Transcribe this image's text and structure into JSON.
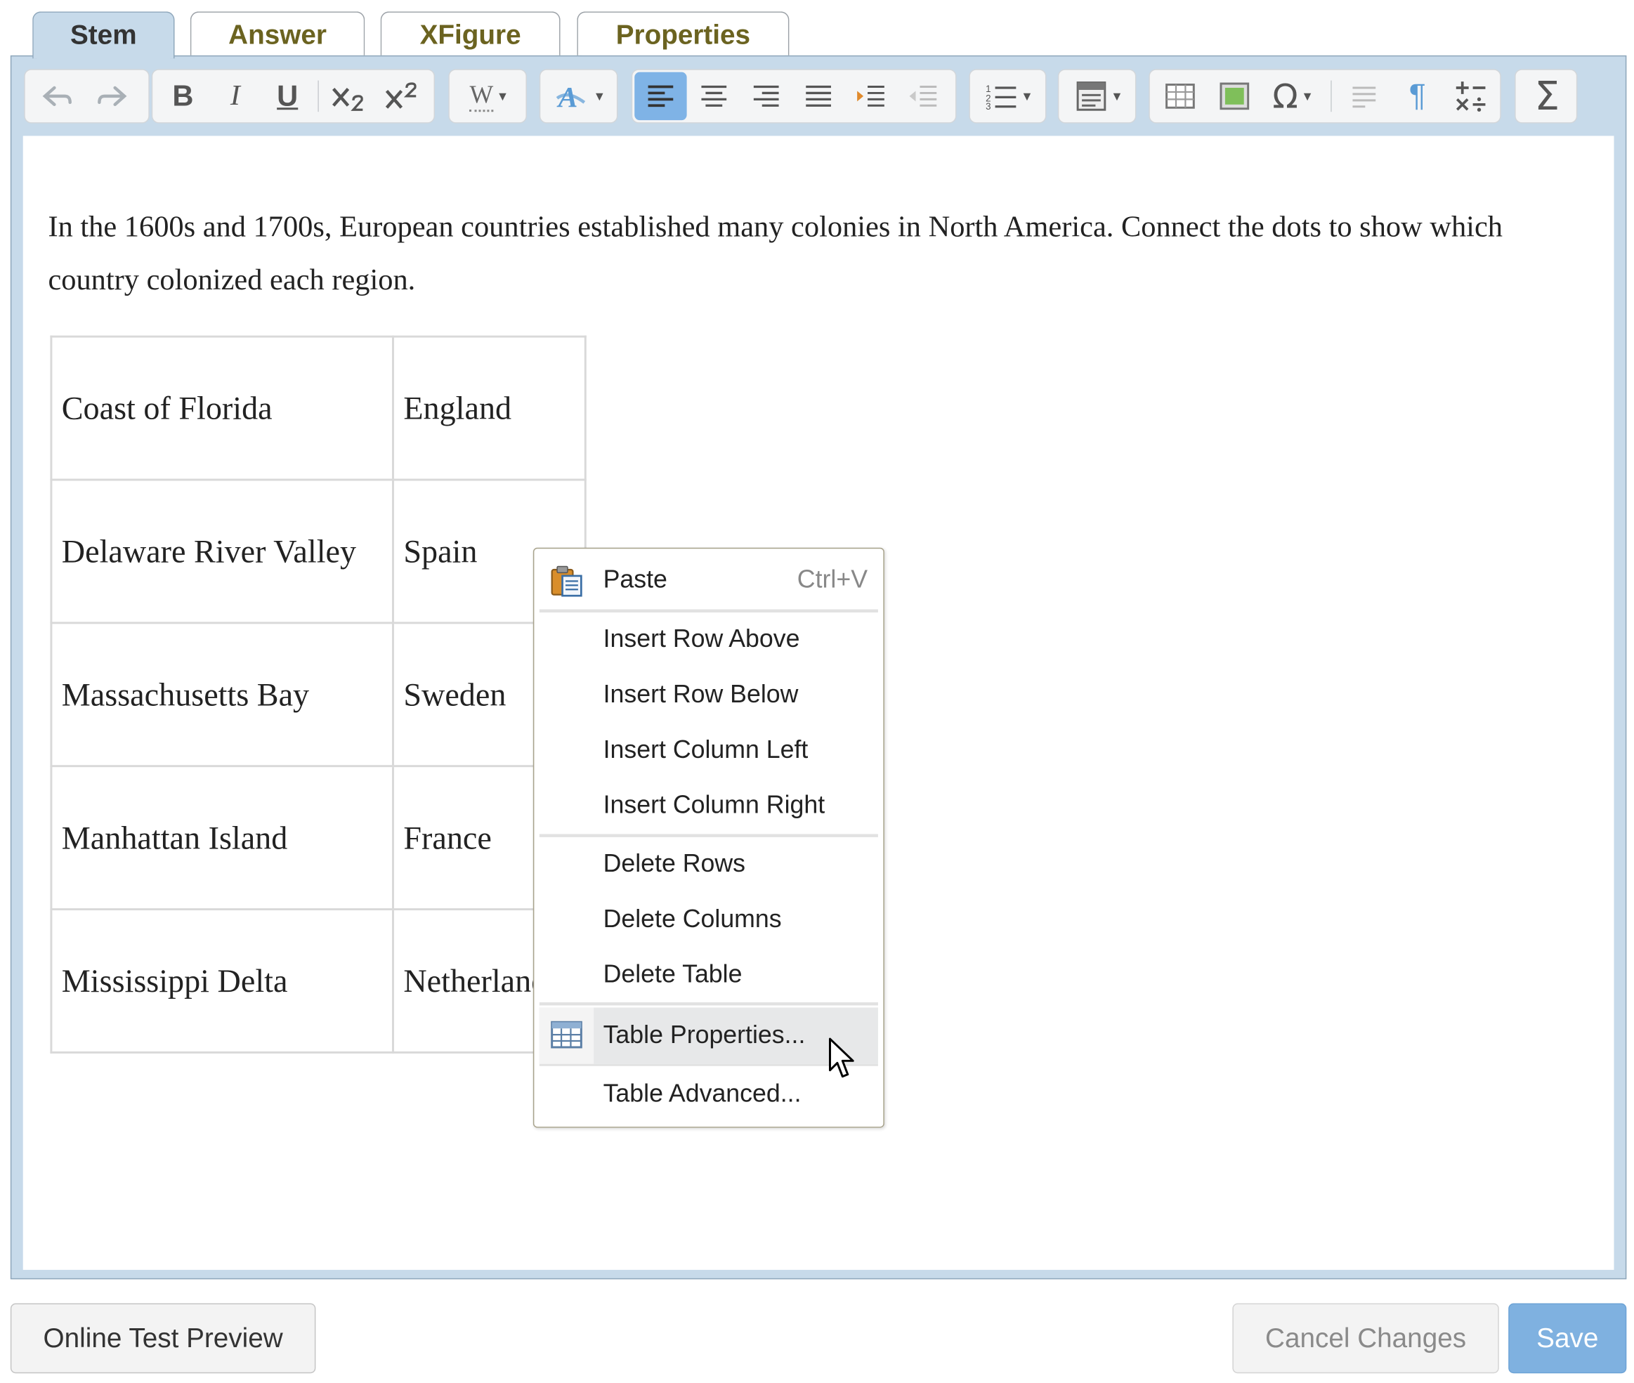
{
  "tabs": [
    {
      "label": "Stem",
      "active": true
    },
    {
      "label": "Answer"
    },
    {
      "label": "XFigure"
    },
    {
      "label": "Properties"
    }
  ],
  "toolbar": {
    "bold": "B",
    "italic": "I",
    "underline": "U",
    "word_style": "W",
    "omega": "Ω",
    "sigma": "Σ",
    "pilcrow": "¶",
    "active_button": "align-left"
  },
  "editor": {
    "stem_text": "In the 1600s and 1700s, European countries established many colonies in North America. Connect the dots to show which country colonized each region.",
    "table": {
      "rows": [
        [
          "Coast of Florida",
          "England"
        ],
        [
          "Delaware River Valley",
          "Spain"
        ],
        [
          "Massachusetts Bay",
          "Sweden"
        ],
        [
          "Manhattan Island",
          "France"
        ],
        [
          "Mississippi Delta",
          "Netherlands"
        ]
      ]
    }
  },
  "context_menu": {
    "paste": "Paste",
    "paste_shortcut": "Ctrl+V",
    "insert_row_above": "Insert Row Above",
    "insert_row_below": "Insert Row Below",
    "insert_column_left": "Insert Column Left",
    "insert_column_right": "Insert Column Right",
    "delete_rows": "Delete Rows",
    "delete_columns": "Delete Columns",
    "delete_table": "Delete Table",
    "table_properties": "Table Properties...",
    "table_advanced": "Table Advanced...",
    "hovered_item": "Table Properties..."
  },
  "footer": {
    "preview": "Online Test Preview",
    "cancel": "Cancel Changes",
    "save": "Save"
  },
  "colors": {
    "editor_frame": "#c7daea",
    "active_toolbar_button": "#7fb3e6",
    "save_button": "#7fb1e0",
    "tab_text": "#6b6320"
  }
}
